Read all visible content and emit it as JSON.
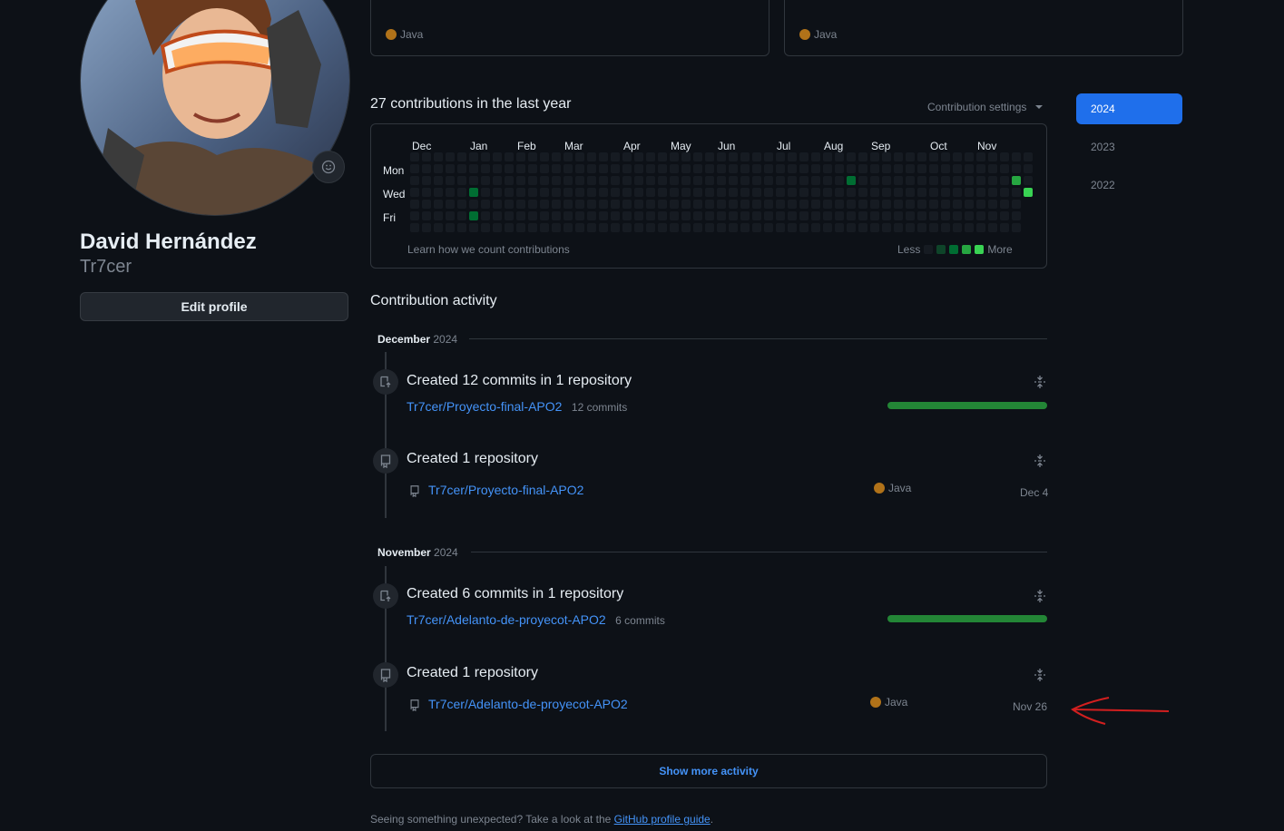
{
  "profile": {
    "name": "David Hernández",
    "login": "Tr7cer",
    "edit_label": "Edit profile"
  },
  "pinned": [
    {
      "language": "Java",
      "language_color": "#b07219"
    },
    {
      "language": "Java",
      "language_color": "#b07219"
    }
  ],
  "contributions": {
    "title": "27 contributions in the last year",
    "settings_label": "Contribution settings",
    "months": [
      "Dec",
      "Jan",
      "Feb",
      "Mar",
      "Apr",
      "May",
      "Jun",
      "Jul",
      "Aug",
      "Sep",
      "Oct",
      "Nov"
    ],
    "days": [
      "Mon",
      "Wed",
      "Fri"
    ],
    "learn_label": "Learn how we count contributions",
    "legend_less": "Less",
    "legend_more": "More",
    "levels": [
      "#161b22",
      "#0e4429",
      "#006d32",
      "#26a641",
      "#39d353"
    ],
    "active_cells": [
      {
        "week": 5,
        "day": 3,
        "level": 2
      },
      {
        "week": 5,
        "day": 5,
        "level": 2
      },
      {
        "week": 37,
        "day": 2,
        "level": 2
      },
      {
        "week": 51,
        "day": 2,
        "level": 3
      },
      {
        "week": 52,
        "day": 3,
        "level": 4
      }
    ]
  },
  "years": [
    "2024",
    "2023",
    "2022"
  ],
  "activity": {
    "title": "Contribution activity",
    "groups": [
      {
        "month": "December",
        "year": "2024",
        "commits_title": "Created 12 commits in 1 repository",
        "commits_repo": "Tr7cer/Proyecto-final-APO2",
        "commits_count": "12 commits",
        "repo_title": "Created 1 repository",
        "repo_name": "Tr7cer/Proyecto-final-APO2",
        "repo_language": "Java",
        "repo_date": "Dec 4"
      },
      {
        "month": "November",
        "year": "2024",
        "commits_title": "Created 6 commits in 1 repository",
        "commits_repo": "Tr7cer/Adelanto-de-proyecot-APO2",
        "commits_count": "6 commits",
        "repo_title": "Created 1 repository",
        "repo_name": "Tr7cer/Adelanto-de-proyecot-APO2",
        "repo_language": "Java",
        "repo_date": "Nov 26"
      }
    ],
    "show_more": "Show more activity"
  },
  "footer": {
    "text": "Seeing something unexpected? Take a look at the",
    "link": "GitHub profile guide",
    "period": "."
  }
}
